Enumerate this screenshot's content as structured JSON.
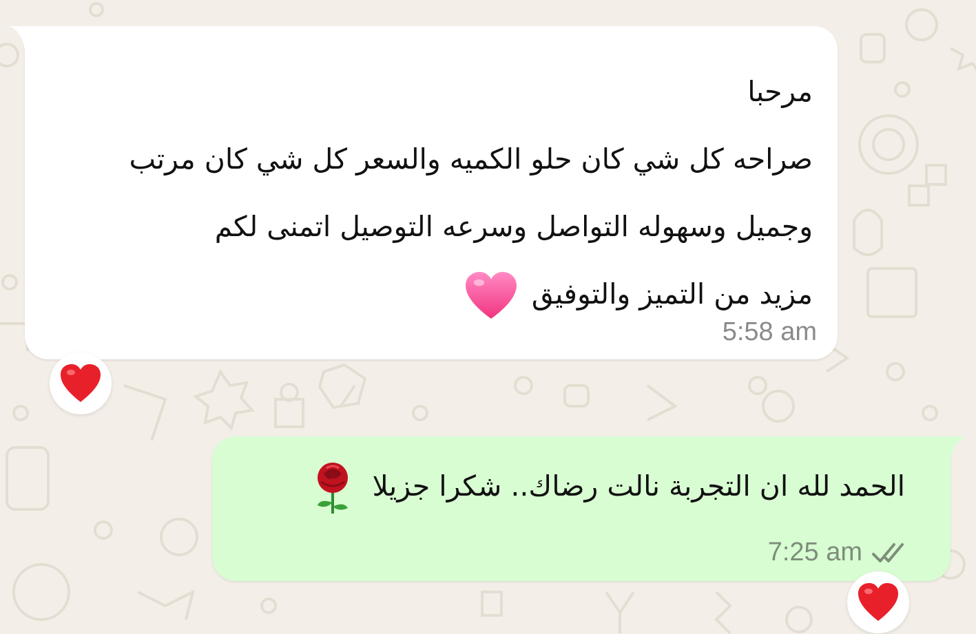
{
  "chat": {
    "messages": [
      {
        "direction": "incoming",
        "text": "مرحبا\nصراحه كل شي كان حلو الكميه والسعر كل شي كان مرتب\nوجميل وسهوله التواصل وسرعه التوصيل  اتمنى لكم\nمزيد من التميز والتوفيق",
        "trailing_emoji": "pink-heart",
        "time": "5:58 am",
        "reaction": "red-heart"
      },
      {
        "direction": "outgoing",
        "text": "الحمد لله ان التجربة نالت رضاك.. شكرا جزيلا",
        "trailing_emoji": "rose",
        "time": "7:25 am",
        "status": "double-check",
        "reaction": "red-heart"
      }
    ]
  },
  "colors": {
    "wallpaper": "#f3efe8",
    "incoming_bubble": "#ffffff",
    "outgoing_bubble": "#d8fdd2",
    "timestamp": "#8a8a8a"
  }
}
